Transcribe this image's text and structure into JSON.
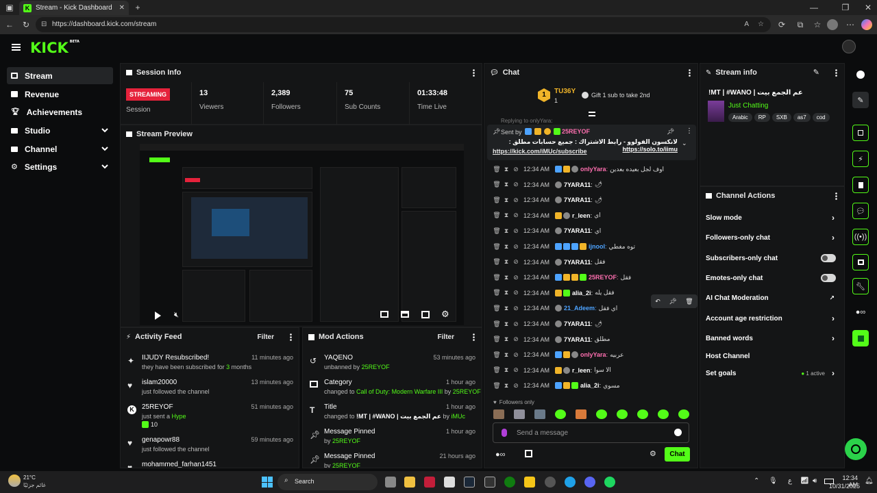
{
  "browser": {
    "tab_title": "Stream - Kick Dashboard",
    "url": "https://dashboard.kick.com/stream"
  },
  "app": {
    "logo": "KICK",
    "logo_badge": "BETA"
  },
  "sidebar": {
    "items": [
      {
        "label": "Stream",
        "icon": "broadcast-icon"
      },
      {
        "label": "Revenue",
        "icon": "revenue-icon"
      },
      {
        "label": "Achievements",
        "icon": "trophy-icon"
      },
      {
        "label": "Studio",
        "icon": "studio-icon"
      },
      {
        "label": "Channel",
        "icon": "channel-icon"
      },
      {
        "label": "Settings",
        "icon": "gear-icon"
      }
    ]
  },
  "session_info": {
    "title": "Session Info",
    "status": "STREAMING",
    "status_label": "Session",
    "stats": [
      {
        "value": "13",
        "label": "Viewers"
      },
      {
        "value": "2,389",
        "label": "Followers"
      },
      {
        "value": "75",
        "label": "Sub Counts"
      },
      {
        "value": "01:33:48",
        "label": "Time Live"
      }
    ]
  },
  "stream_preview": {
    "title": "Stream Preview"
  },
  "activity_feed": {
    "title": "Activity Feed",
    "filter": "Filter",
    "items": [
      {
        "icon": "star-icon",
        "title": "IIJUDY Resubscribed!",
        "sub_pre": "they have been subscribed for ",
        "sub_hl": "3",
        "sub_post": " months",
        "time": "11 minutes ago"
      },
      {
        "icon": "heart-icon",
        "title": "islam20000",
        "sub_pre": "just followed the channel",
        "sub_hl": "",
        "sub_post": "",
        "time": "13 minutes ago"
      },
      {
        "icon": "kick-icon",
        "title": "25REYOF",
        "sub_pre": "just sent a ",
        "sub_hl": "Hype",
        "sub_post": "",
        "extra": "10",
        "time": "51 minutes ago"
      },
      {
        "icon": "heart-icon",
        "title": "genapowr88",
        "sub_pre": "just followed the channel",
        "sub_hl": "",
        "sub_post": "",
        "time": "59 minutes ago"
      },
      {
        "icon": "heart-icon",
        "title": "mohammed_farhan1451",
        "sub_pre": "",
        "sub_hl": "",
        "sub_post": "",
        "time": ""
      }
    ]
  },
  "mod_actions": {
    "title": "Mod Actions",
    "filter": "Filter",
    "items": [
      {
        "icon": "undo-icon",
        "title": "YAQENO",
        "sub_pre": "unbanned by ",
        "sub_hl": "25REYOF",
        "time": "53 minutes ago"
      },
      {
        "icon": "category-icon",
        "title": "Category",
        "sub_pre": "changed to ",
        "sub_hl": "Call of Duty: Modern Warfare III",
        "sub_post": " by ",
        "sub_hl2": "25REYOF",
        "time": "1 hour ago"
      },
      {
        "icon": "title-icon",
        "title": "Title",
        "sub_pre": "changed to ",
        "sub_hl": "!MT | #WANO | عم الجمع بيت",
        "sub_post": " by ",
        "sub_hl2": "iMUc",
        "time": "1 hour ago"
      },
      {
        "icon": "pin-icon",
        "title": "Message Pinned",
        "sub_pre": "by ",
        "sub_hl": "25REYOF",
        "time": "1 hour ago"
      },
      {
        "icon": "pin-icon",
        "title": "Message Pinned",
        "sub_pre": "by ",
        "sub_hl": "25REYOF",
        "time": "21 hours ago"
      }
    ]
  },
  "chat": {
    "title": "Chat",
    "gifter_name": "TU36Y",
    "gifter_count": "1",
    "gift_prompt": "Gift 1 sub to take 2nd",
    "replying": "Replying to onlyYara:",
    "pinned_sender_label": "Sent by",
    "pinned_sender": "25REYOF",
    "pinned_text_1": "لانكسون الفولوو - رابط الاشتراك : جميع حسابات مطلق : ",
    "pinned_link_1": "https://solo.to/iimu",
    "pinned_link_2": "https://kick.com/iMUc/subscribe",
    "messages": [
      {
        "time": "12:34 AM",
        "name": "onlyYara",
        "color": "#ff6fb0",
        "msg": "اوف لجل بعيده بعدين"
      },
      {
        "time": "12:34 AM",
        "name": "7YARA11",
        "color": "#ffffff",
        "msg": "🌶"
      },
      {
        "time": "12:34 AM",
        "name": "7YARA11",
        "color": "#ffffff",
        "msg": "🌶"
      },
      {
        "time": "12:34 AM",
        "name": "r_leen",
        "color": "#ffffff",
        "msg": "اي"
      },
      {
        "time": "12:34 AM",
        "name": "7YARA11",
        "color": "#ffffff",
        "msg": "اي"
      },
      {
        "time": "12:34 AM",
        "name": "ijnool",
        "color": "#4da3ff",
        "msg": "توه مغطي"
      },
      {
        "time": "12:34 AM",
        "name": "7YARA11",
        "color": "#ffffff",
        "msg": "فقل"
      },
      {
        "time": "12:34 AM",
        "name": "25REYOF",
        "color": "#ff6fb0",
        "msg": "فقل"
      },
      {
        "time": "12:34 AM",
        "name": "alia_2i",
        "color": "#ffffff",
        "msg": "فقل يله"
      },
      {
        "time": "12:34 AM",
        "name": "21_Adeem",
        "color": "#4da3ff",
        "msg": "اي فقل"
      },
      {
        "time": "12:34 AM",
        "name": "7YARA11",
        "color": "#ffffff",
        "msg": "🌶"
      },
      {
        "time": "12:34 AM",
        "name": "7YARA11",
        "color": "#ffffff",
        "msg": "مطلق"
      },
      {
        "time": "12:34 AM",
        "name": "onlyYara",
        "color": "#ff6fb0",
        "msg": "عربيه"
      },
      {
        "time": "12:34 AM",
        "name": "r_leen",
        "color": "#ffffff",
        "msg": "الا سوا"
      },
      {
        "time": "12:34 AM",
        "name": "alia_2i",
        "color": "#ffffff",
        "msg": "مسوي"
      }
    ],
    "followers_only": "Followers only",
    "input_placeholder": "Send a message",
    "send_button": "Chat"
  },
  "stream_info": {
    "title": "Stream info",
    "stream_title": "!MT | #WANO | عم الجمع بيت",
    "category": "Just Chatting",
    "tags": [
      "Arabic",
      "RP",
      "SXB",
      "as7",
      "cod"
    ]
  },
  "channel_actions": {
    "title": "Channel Actions",
    "items": [
      {
        "label": "Slow mode",
        "kind": "chevron"
      },
      {
        "label": "Followers-only chat",
        "kind": "chevron"
      },
      {
        "label": "Subscribers-only chat",
        "kind": "toggle"
      },
      {
        "label": "Emotes-only chat",
        "kind": "toggle"
      },
      {
        "label": "AI Chat Moderation",
        "kind": "external"
      },
      {
        "label": "Account age restriction",
        "kind": "chevron"
      },
      {
        "label": "Banned words",
        "kind": "chevron"
      },
      {
        "label": "Host Channel",
        "kind": "none"
      },
      {
        "label": "Set goals",
        "kind": "chevron",
        "status": "1 active"
      }
    ]
  },
  "taskbar": {
    "weather_temp": "21°C",
    "weather_desc": "غائم جزئيًا",
    "search": "Search",
    "time": "12:34 AM",
    "date": "10/31/2025",
    "lang": "ع"
  },
  "colors": {
    "accent": "#53fc18",
    "streaming": "#e5223b",
    "panel": "#141516"
  }
}
